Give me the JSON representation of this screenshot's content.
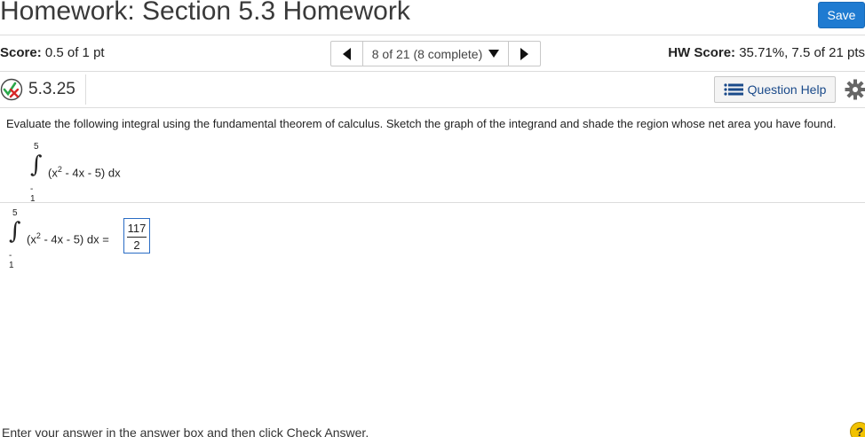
{
  "header": {
    "title": "Homework: Section 5.3 Homework",
    "save_label": "Save"
  },
  "score_bar": {
    "score_label": "Score:",
    "score_value": "0.5 of 1 pt",
    "nav_text": "8 of 21 (8 complete)",
    "hw_score_label": "HW Score:",
    "hw_score_value": "35.71%, 7.5 of 21 pts"
  },
  "question": {
    "id": "5.3.25",
    "status_icon": "partial-credit-icon",
    "help_label": "Question Help",
    "instruction": "Evaluate the following integral using the fundamental theorem of calculus. Sketch the graph of the integrand and shade the region whose net area you have found.",
    "integral": {
      "upper": "5",
      "lower": "- 1",
      "open": "(x",
      "power": "2",
      "rest": " - 4x - 5) dx"
    },
    "answer_row": {
      "upper": "5",
      "lower": "- 1",
      "open": "(x",
      "power": "2",
      "rest": " - 4x - 5) dx =",
      "numerator": "117",
      "denominator": "2"
    }
  },
  "footer": {
    "text": "Enter your answer in the answer box and then click Check Answer.",
    "help_symbol": "?"
  },
  "colors": {
    "save_button": "#1f7bd1",
    "answer_border": "#2a6cc4",
    "help_circle": "#f2c200"
  }
}
